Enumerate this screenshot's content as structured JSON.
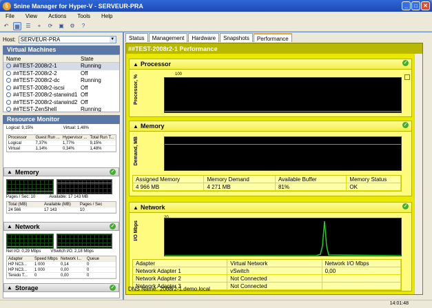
{
  "window": {
    "title": "5nine Manager for Hyper-V - SERVEUR-PRA"
  },
  "menu": [
    "File",
    "View",
    "Actions",
    "Tools",
    "Help"
  ],
  "host": {
    "label": "Host:",
    "value": "SERVEUR-PRA"
  },
  "virtual_machines": {
    "title": "Virtual Machines",
    "columns": [
      "Name",
      "State"
    ],
    "rows": [
      {
        "name": "##TEST-2008r2-1",
        "state": "Running"
      },
      {
        "name": "##TEST-2008r2-2",
        "state": "Off"
      },
      {
        "name": "##TEST-2008r2-dc",
        "state": "Running"
      },
      {
        "name": "##TEST-2008r2-iscsi",
        "state": "Off"
      },
      {
        "name": "##TEST-2008r2-starwind1",
        "state": "Off"
      },
      {
        "name": "##TEST-2008r2-starwind2",
        "state": "Off"
      },
      {
        "name": "##TEST-ZenShell",
        "state": "Running"
      }
    ]
  },
  "resource_monitor": {
    "title": "Resource Monitor",
    "cpu_labels": {
      "logical": "Logical: 9,15%",
      "virtual": "Virtual: 1,48%"
    },
    "cpu_table": {
      "columns": [
        "Processor",
        "Guest Run ...",
        "Hypervisor ...",
        "Total Run T..."
      ],
      "rows": [
        [
          "Logical",
          "7,37%",
          "1,77%",
          "9,15%"
        ],
        [
          "Virtual",
          "1,14%",
          "0,34%",
          "1,48%"
        ]
      ]
    },
    "memory": {
      "title": "Memory",
      "pages_label": "Pages / Sec: 10",
      "available_label": "Available: 17 143 MB",
      "columns": [
        "Total (MB)",
        "Available (MB)",
        "Pages / Sec"
      ],
      "row": [
        "24 566",
        "17 143",
        "10"
      ]
    },
    "network": {
      "title": "Network",
      "net_io_label": "Net I/O: 0,29 Mbps",
      "vswitch_label": "VSwitch I/O: 2,18 Mbps",
      "columns": [
        "Adapter",
        "Speed Mbps",
        "Network I...",
        "Queue"
      ],
      "rows": [
        [
          "HP NC3...",
          "1 000",
          "0,14",
          "0"
        ],
        [
          "HP NC3...",
          "1 000",
          "0,00",
          "0"
        ],
        [
          "Teredo T...",
          "0",
          "0,00",
          "0"
        ]
      ]
    },
    "storage": {
      "title": "Storage"
    }
  },
  "tabs": [
    "Status",
    "Management",
    "Hardware",
    "Snapshots",
    "Performance"
  ],
  "active_tab": "Performance",
  "performance": {
    "title": "##TEST-2008r2-1 Performance",
    "processor": {
      "title": "Processor",
      "ylabel": "Processor, %",
      "ymax": "100"
    },
    "memory": {
      "title": "Memory",
      "ylabel": "Demand, MB",
      "columns": [
        "Assigned Memory",
        "Memory Demand",
        "Available Buffer",
        "Memory Status"
      ],
      "row": [
        "4 966 MB",
        "4 271 MB",
        "81%",
        "OK"
      ]
    },
    "network": {
      "title": "Network",
      "ylabel": "I/O Mbps",
      "ymax": "20",
      "columns": [
        "Adapter",
        "Virtual Network",
        "Network I/O Mbps"
      ],
      "rows": [
        [
          "Network Adapter 1",
          "vSwitch",
          "0,00"
        ],
        [
          "Network Adapter 2",
          "Not Connected",
          ""
        ],
        [
          "Network Adapter 3",
          "Not Connected",
          ""
        ]
      ]
    },
    "dns": {
      "label": "DNS Name:",
      "value": "2008r2-1.demo.local"
    }
  },
  "status": {
    "time": "14:01:48"
  },
  "colors": {
    "titlebar": "#2f67d6",
    "perf_panel": "#e8e800",
    "graph_line": "#1fd01f",
    "ok": "#3fae2a"
  }
}
